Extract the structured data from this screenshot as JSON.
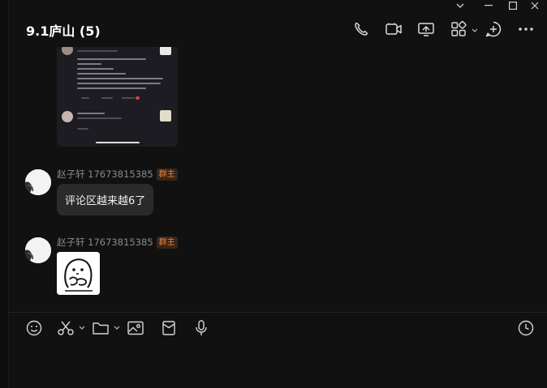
{
  "window": {
    "controls": [
      "chevron-down",
      "minimize",
      "maximize",
      "close"
    ]
  },
  "header": {
    "title": "9.1庐山 (5)",
    "actions": [
      "phone-icon",
      "video-icon",
      "screen-share-icon",
      "apps-icon",
      "add-chat-icon",
      "more-icon"
    ]
  },
  "messages": [
    {
      "type": "image",
      "content": "screenshot of comments"
    },
    {
      "sender": "赵子轩 17673815385",
      "badge": "群主",
      "text": "评论区越来越6了"
    },
    {
      "sender": "赵子轩 17673815385",
      "badge": "群主",
      "type": "sticker"
    }
  ],
  "toolbar": {
    "tools": [
      "emoji-icon",
      "scissors-icon",
      "folder-icon",
      "image-icon",
      "red-packet-icon",
      "microphone-icon",
      "history-icon"
    ]
  },
  "colors": {
    "background": "#111111",
    "bubble": "#2b2b2b",
    "badge_text": "#e8873f",
    "badge_bg": "#3a2516"
  }
}
